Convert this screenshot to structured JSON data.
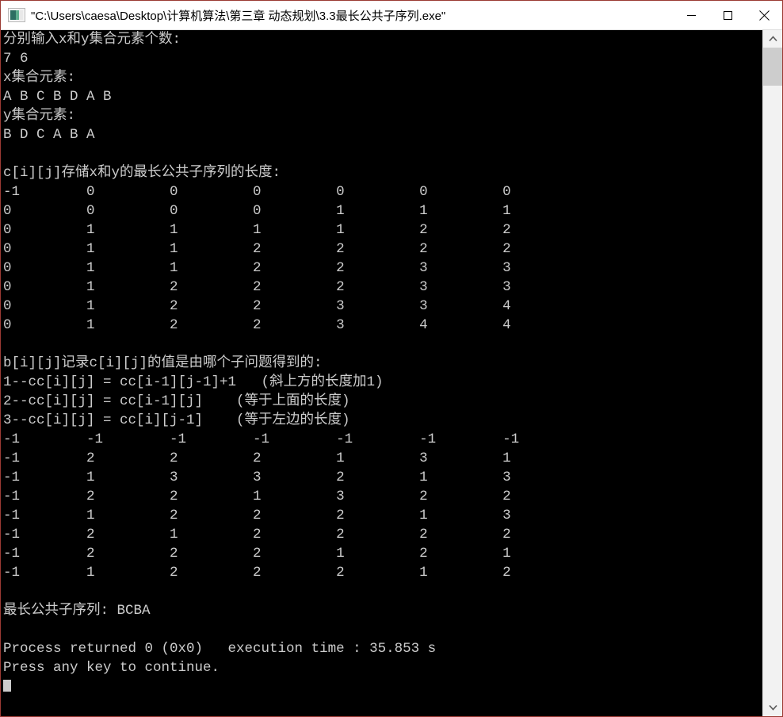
{
  "window": {
    "title": "\"C:\\Users\\caesa\\Desktop\\计算机算法\\第三章 动态规划\\3.3最长公共子序列.exe\"",
    "icon": "console-app-icon",
    "background_color": "#000000",
    "text_color": "#cccccc",
    "border_color": "#9b3a33"
  },
  "titlebar": {
    "minimize_label": "minimize",
    "maximize_label": "maximize",
    "close_label": "close"
  },
  "scrollbar": {
    "up_arrow": "scroll-up",
    "down_arrow": "scroll-down",
    "thumb": "scroll-thumb"
  },
  "console": {
    "prompt_counts": "分别输入x和y集合元素个数:",
    "input_counts": "7 6",
    "label_x_set": "x集合元素:",
    "x_elements": "A B C B D A B",
    "label_y_set": "y集合元素:",
    "y_elements": "B D C A B A",
    "c_header": "c[i][j]存储x和y的最长公共子序列的长度:",
    "c_matrix": [
      [
        "-1",
        "0",
        "0",
        "0",
        "0",
        "0",
        "0"
      ],
      [
        "0",
        "0",
        "0",
        "0",
        "1",
        "1",
        "1"
      ],
      [
        "0",
        "1",
        "1",
        "1",
        "1",
        "2",
        "2"
      ],
      [
        "0",
        "1",
        "1",
        "2",
        "2",
        "2",
        "2"
      ],
      [
        "0",
        "1",
        "1",
        "2",
        "2",
        "3",
        "3"
      ],
      [
        "0",
        "1",
        "2",
        "2",
        "2",
        "3",
        "3"
      ],
      [
        "0",
        "1",
        "2",
        "2",
        "3",
        "3",
        "4"
      ],
      [
        "0",
        "1",
        "2",
        "2",
        "3",
        "4",
        "4"
      ]
    ],
    "b_header": "b[i][j]记录c[i][j]的值是由哪个子问题得到的:",
    "b_rule_1": "1--cc[i][j] = cc[i-1][j-1]+1   (斜上方的长度加1)",
    "b_rule_2": "2--cc[i][j] = cc[i-1][j]    (等于上面的长度)",
    "b_rule_3": "3--cc[i][j] = cc[i][j-1]    (等于左边的长度)",
    "b_matrix": [
      [
        "-1",
        "-1",
        "-1",
        "-1",
        "-1",
        "-1",
        "-1"
      ],
      [
        "-1",
        "2",
        "2",
        "2",
        "1",
        "3",
        "1"
      ],
      [
        "-1",
        "1",
        "3",
        "3",
        "2",
        "1",
        "3"
      ],
      [
        "-1",
        "2",
        "2",
        "1",
        "3",
        "2",
        "2"
      ],
      [
        "-1",
        "1",
        "2",
        "2",
        "2",
        "1",
        "3"
      ],
      [
        "-1",
        "2",
        "1",
        "2",
        "2",
        "2",
        "2"
      ],
      [
        "-1",
        "2",
        "2",
        "2",
        "1",
        "2",
        "1"
      ],
      [
        "-1",
        "1",
        "2",
        "2",
        "2",
        "1",
        "2"
      ]
    ],
    "result_label": "最长公共子序列: BCBA",
    "process_line": "Process returned 0 (0x0)   execution time : 35.853 s",
    "press_key_line": "Press any key to continue."
  }
}
